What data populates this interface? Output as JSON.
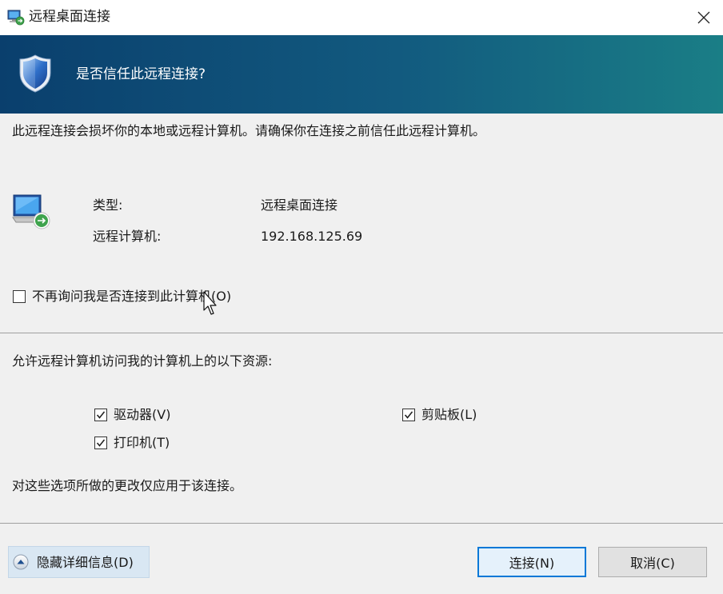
{
  "window": {
    "title": "远程桌面连接",
    "close_icon": "close-icon"
  },
  "banner": {
    "question": "是否信任此远程连接?",
    "icon": "shield-icon"
  },
  "warning": "此远程连接会损坏你的本地或远程计算机。请确保你在连接之前信任此远程计算机。",
  "connection_info": {
    "icon": "computer-icon",
    "type_label": "类型:",
    "type_value": "远程桌面连接",
    "remote_label": "远程计算机:",
    "remote_value": "192.168.125.69"
  },
  "dont_ask": {
    "label": "不再询问我是否连接到此计算机(O)",
    "checked": false
  },
  "resources": {
    "heading": "允许远程计算机访问我的计算机上的以下资源:",
    "items": [
      {
        "label": "驱动器(V)",
        "checked": true
      },
      {
        "label": "剪贴板(L)",
        "checked": true
      },
      {
        "label": "打印机(T)",
        "checked": true
      }
    ],
    "note": "对这些选项所做的更改仅应用于该连接。"
  },
  "footer": {
    "details_label": "隐藏详细信息(D)",
    "connect_label": "连接(N)",
    "cancel_label": "取消(C)"
  },
  "colors": {
    "banner_start": "#0a3f6d",
    "banner_end": "#1a7e86",
    "accent": "#0078d7"
  }
}
